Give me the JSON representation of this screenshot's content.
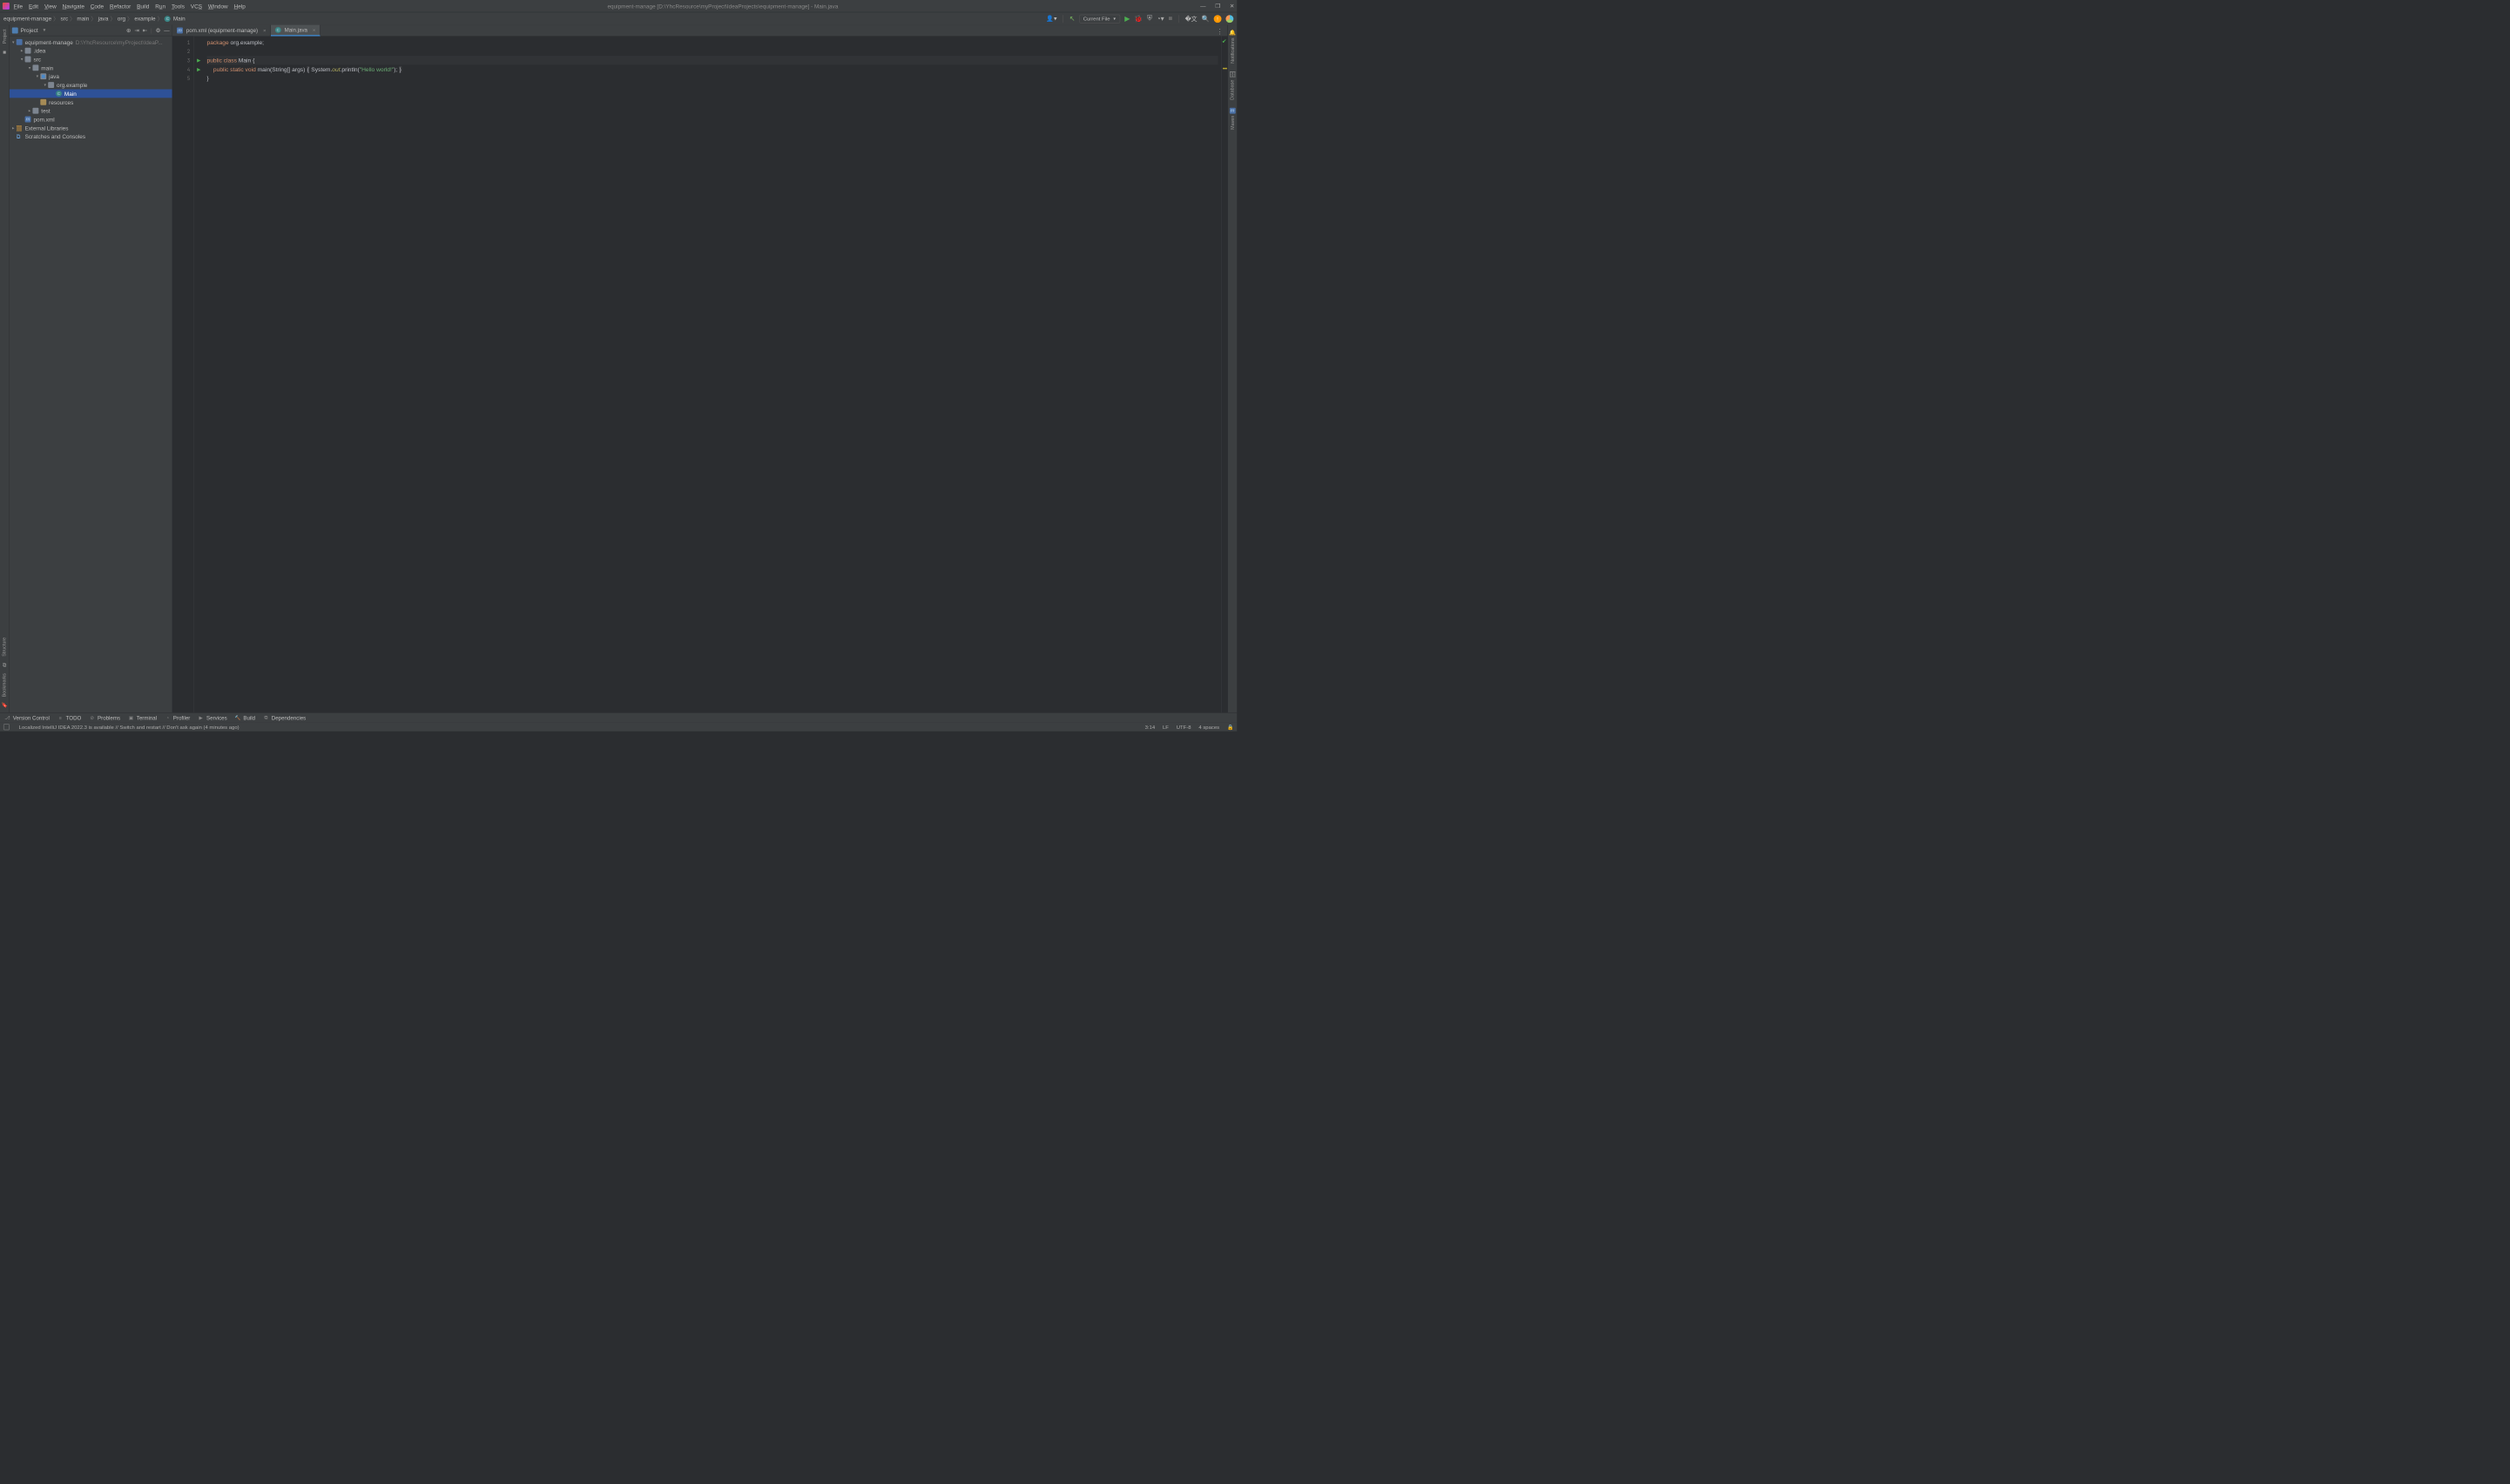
{
  "menubar": {
    "file": "File",
    "edit": "Edit",
    "view": "View",
    "navigate": "Navigate",
    "code": "Code",
    "refactor": "Refactor",
    "build": "Build",
    "run": "Run",
    "tools": "Tools",
    "vcs": "VCS",
    "window": "Window",
    "help": "Help"
  },
  "title": "equipment-manage [D:\\YhcResource\\myProject\\IdeaProjects\\equipment-manage] - Main.java",
  "breadcrumbs": {
    "items": [
      "equipment-manage",
      "src",
      "main",
      "java",
      "org",
      "example",
      "Main"
    ]
  },
  "run_config": "Current File",
  "project_panel": {
    "title": "Project",
    "root": {
      "name": "equipment-manage",
      "path": "D:\\YhcResource\\myProject\\IdeaP..."
    },
    "idea": ".idea",
    "src": "src",
    "main": "main",
    "java": "java",
    "pkg": "org.example",
    "cls": "Main",
    "resources": "resources",
    "test": "test",
    "pom": "pom.xml",
    "ext": "External Libraries",
    "scratches": "Scratches and Consoles"
  },
  "tabs": {
    "pom": "pom.xml (equipment-manage)",
    "main": "Main.java"
  },
  "code": {
    "l1_pkg": "package",
    "l1_rest": "org.example",
    "l3_pub": "public",
    "l3_cls": "class",
    "l3_name": "Main",
    "l3_brace": "{",
    "l4_pub": "public",
    "l4_static": "static",
    "l4_void": "void",
    "l4_main": "main",
    "l4_args": "(String[] args)",
    "l4_open": "{",
    "l4_sys": "System.",
    "l4_out": "out",
    "l4_print": ".println(",
    "l4_str": "\"Hello world!\"",
    "l4_end": ");",
    "l4_close": "}",
    "l5": "}"
  },
  "line_numbers": [
    "1",
    "2",
    "3",
    "4",
    "5"
  ],
  "bottom_tools": {
    "vc": "Version Control",
    "todo": "TODO",
    "problems": "Problems",
    "terminal": "Terminal",
    "profiler": "Profiler",
    "services": "Services",
    "build": "Build",
    "deps": "Dependencies"
  },
  "statusbar": {
    "msg": "Localized IntelliJ IDEA 2022.3 is available // Switch and restart // Don't ask again (4 minutes ago)",
    "pos": "3:14",
    "le": "LF",
    "enc": "UTF-8",
    "indent": "4 spaces"
  },
  "right_tools": {
    "notif": "Notifications",
    "db": "Database",
    "maven": "Maven"
  }
}
